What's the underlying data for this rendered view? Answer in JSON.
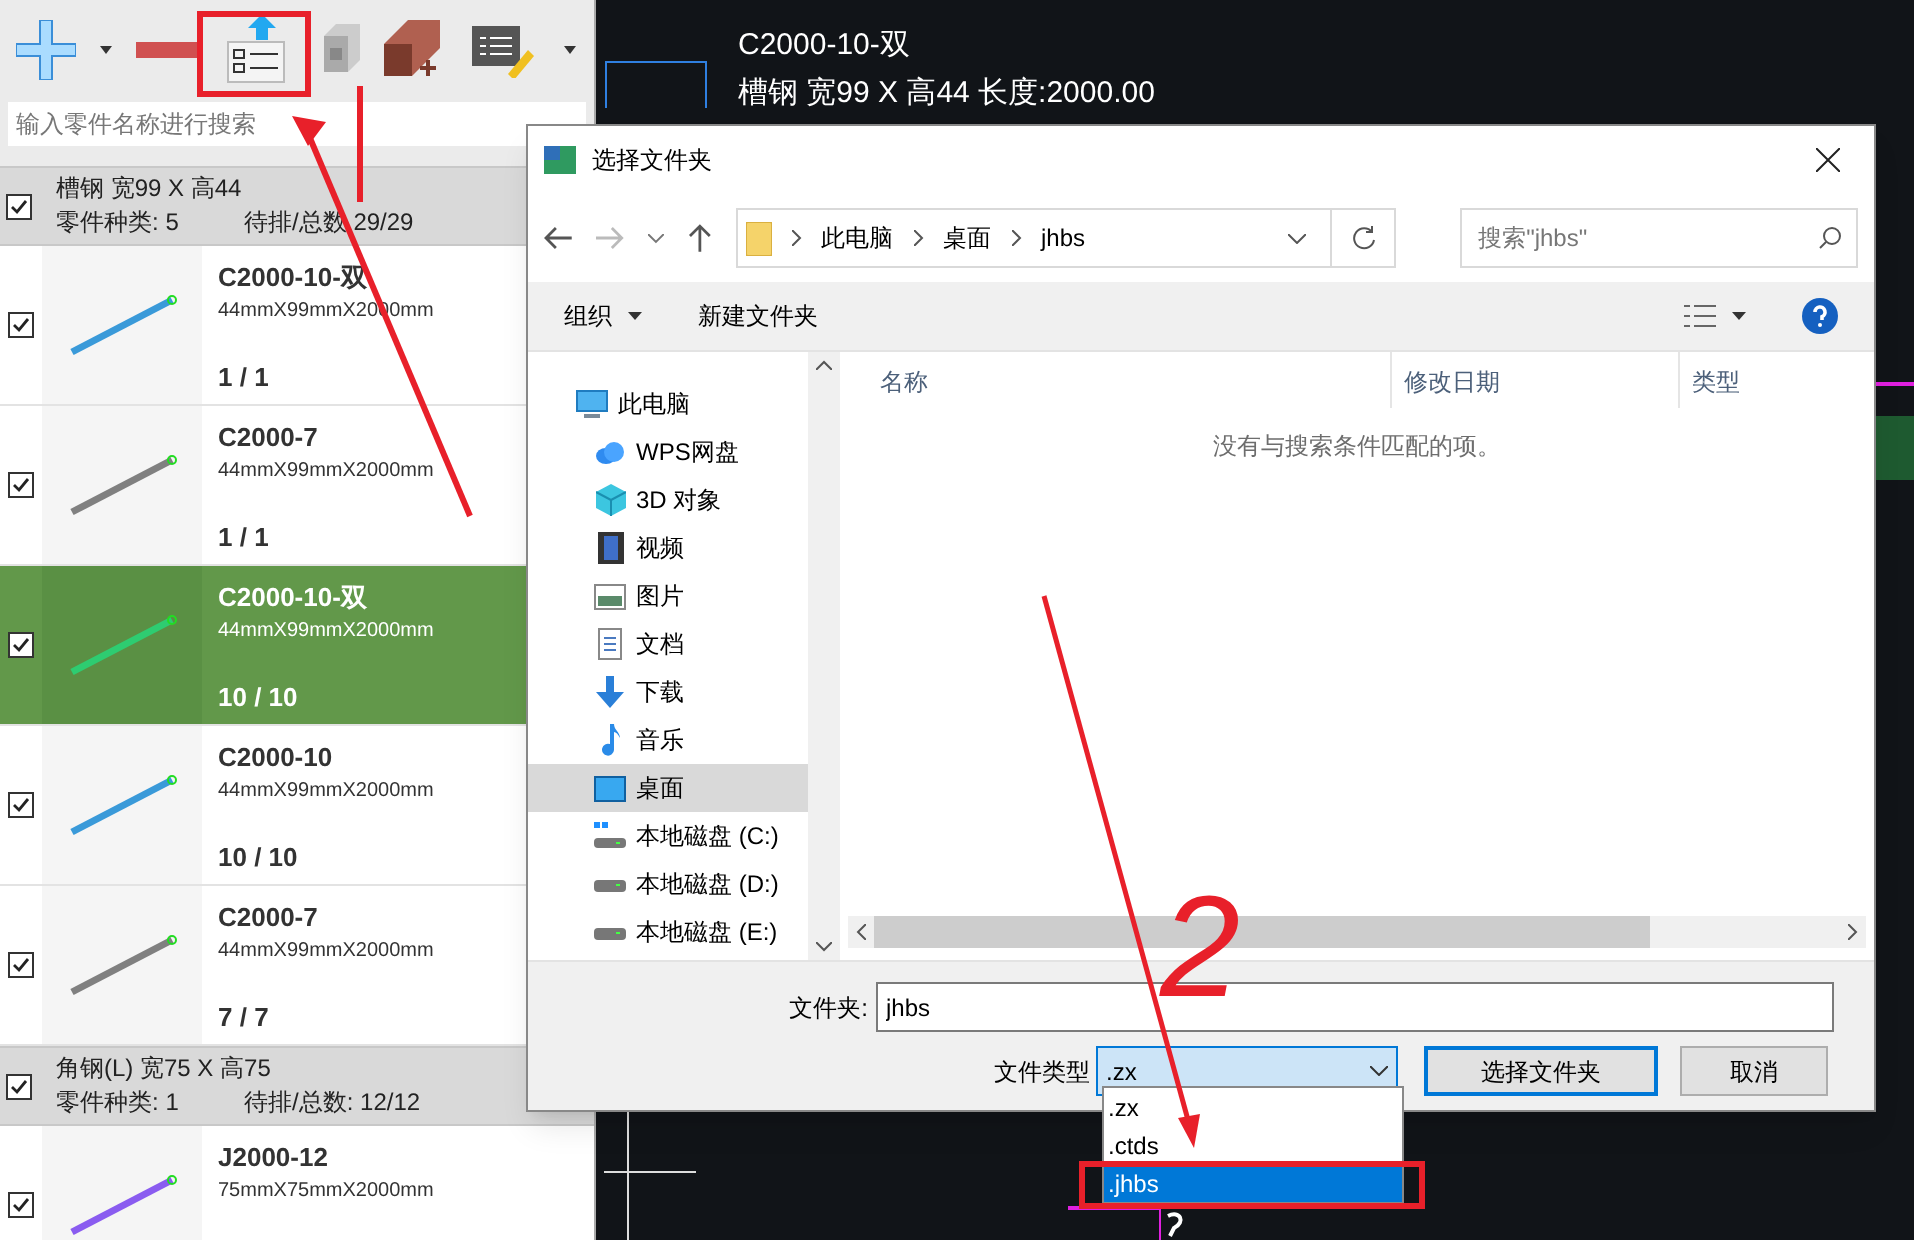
{
  "search": {
    "placeholder": "输入零件名称进行搜索"
  },
  "groups": [
    {
      "title": "槽钢 宽99 X 高44",
      "count_label": "零件种类:",
      "count": "5",
      "pending_label": "待排/总数",
      "pending": "29/29",
      "checked": true,
      "parts": [
        {
          "name": "C2000-10-双",
          "size": "44mmX99mmX2000mm",
          "qty": "1 / 1",
          "checked": true,
          "selected": false,
          "color": "#3a9ad9"
        },
        {
          "name": "C2000-7",
          "size": "44mmX99mmX2000mm",
          "qty": "1 / 1",
          "checked": true,
          "selected": false,
          "color": "#808080"
        },
        {
          "name": "C2000-10-双",
          "size": "44mmX99mmX2000mm",
          "qty": "10 / 10",
          "checked": true,
          "selected": true,
          "color": "#2ecc71"
        },
        {
          "name": "C2000-10",
          "size": "44mmX99mmX2000mm",
          "qty": "10 / 10",
          "checked": true,
          "selected": false,
          "color": "#3a9ad9"
        },
        {
          "name": "C2000-7",
          "size": "44mmX99mmX2000mm",
          "qty": "7 / 7",
          "checked": true,
          "selected": false,
          "color": "#808080"
        }
      ]
    },
    {
      "title": "角钢(L) 宽75 X 高75",
      "count_label": "零件种类:",
      "count": "1",
      "pending_label": "待排/总数:",
      "pending": "12/12",
      "checked": true,
      "parts": [
        {
          "name": "J2000-12",
          "size": "75mmX75mmX2000mm",
          "checked": true,
          "selected": false,
          "color": "#8a5cf0"
        }
      ]
    }
  ],
  "canvas": {
    "title": "C2000-10-双",
    "subtitle": "槽钢 宽99 X 高44 长度:2000.00"
  },
  "dialog": {
    "title": "选择文件夹",
    "path": [
      "此电脑",
      "桌面",
      "jhbs"
    ],
    "search_placeholder": "搜索\"jhbs\"",
    "organize": "组织",
    "new_folder": "新建文件夹",
    "nav": [
      {
        "label": "此电脑",
        "kind": "pc",
        "selected": false
      },
      {
        "label": "WPS网盘",
        "kind": "cloud",
        "selected": false
      },
      {
        "label": "3D 对象",
        "kind": "cube",
        "selected": false
      },
      {
        "label": "视频",
        "kind": "video",
        "selected": false
      },
      {
        "label": "图片",
        "kind": "image",
        "selected": false
      },
      {
        "label": "文档",
        "kind": "doc",
        "selected": false
      },
      {
        "label": "下载",
        "kind": "download",
        "selected": false
      },
      {
        "label": "音乐",
        "kind": "music",
        "selected": false
      },
      {
        "label": "桌面",
        "kind": "desktop",
        "selected": true
      },
      {
        "label": "本地磁盘 (C:)",
        "kind": "sysdrive",
        "selected": false
      },
      {
        "label": "本地磁盘 (D:)",
        "kind": "drive",
        "selected": false
      },
      {
        "label": "本地磁盘 (E:)",
        "kind": "drive",
        "selected": false
      }
    ],
    "columns": [
      "名称",
      "修改日期",
      "类型"
    ],
    "empty_message": "没有与搜索条件匹配的项。",
    "folder_label": "文件夹:",
    "folder_value": "jhbs",
    "type_label": "文件类型",
    "type_value": ".zx",
    "type_options": [
      {
        "label": ".zx",
        "selected": false
      },
      {
        "label": ".ctds",
        "selected": false
      },
      {
        "label": ".jhbs",
        "selected": true
      }
    ],
    "buttons": [
      "选择文件夹",
      "取消"
    ]
  },
  "annotation": {
    "step": "2"
  }
}
